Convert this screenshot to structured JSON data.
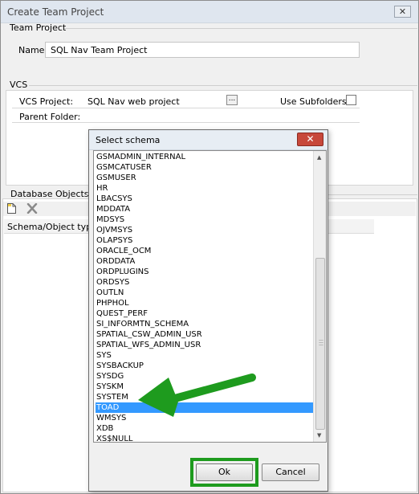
{
  "window": {
    "title": "Create Team Project",
    "close": "✕"
  },
  "team_project": {
    "group": "Team Project",
    "name_label": "Name:",
    "name_value": "SQL Nav Team Project"
  },
  "vcs": {
    "group": "VCS",
    "project_label": "VCS Project:",
    "project_value": "SQL Nav web project",
    "browse": "...",
    "use_subfolders_label": "Use Subfolders:",
    "use_subfolders_checked": false,
    "parent_folder_label": "Parent Folder:"
  },
  "db_objects": {
    "group": "Database Objects",
    "column": "Schema/Object type"
  },
  "dialog": {
    "title": "Select schema",
    "close": "✕",
    "selected": "TOAD",
    "schemas": [
      "GSMADMIN_INTERNAL",
      "GSMCATUSER",
      "GSMUSER",
      "HR",
      "LBACSYS",
      "MDDATA",
      "MDSYS",
      "OJVMSYS",
      "OLAPSYS",
      "ORACLE_OCM",
      "ORDDATA",
      "ORDPLUGINS",
      "ORDSYS",
      "OUTLN",
      "PHPHOL",
      "QUEST_PERF",
      "SI_INFORMTN_SCHEMA",
      "SPATIAL_CSW_ADMIN_USR",
      "SPATIAL_WFS_ADMIN_USR",
      "SYS",
      "SYSBACKUP",
      "SYSDG",
      "SYSKM",
      "SYSTEM",
      "TOAD",
      "WMSYS",
      "XDB",
      "XS$NULL"
    ],
    "ok_label": "Ok",
    "cancel_label": "Cancel"
  },
  "annotation": {
    "arrow_color": "#1e9b1e",
    "highlight_color": "#1e9b1e"
  }
}
